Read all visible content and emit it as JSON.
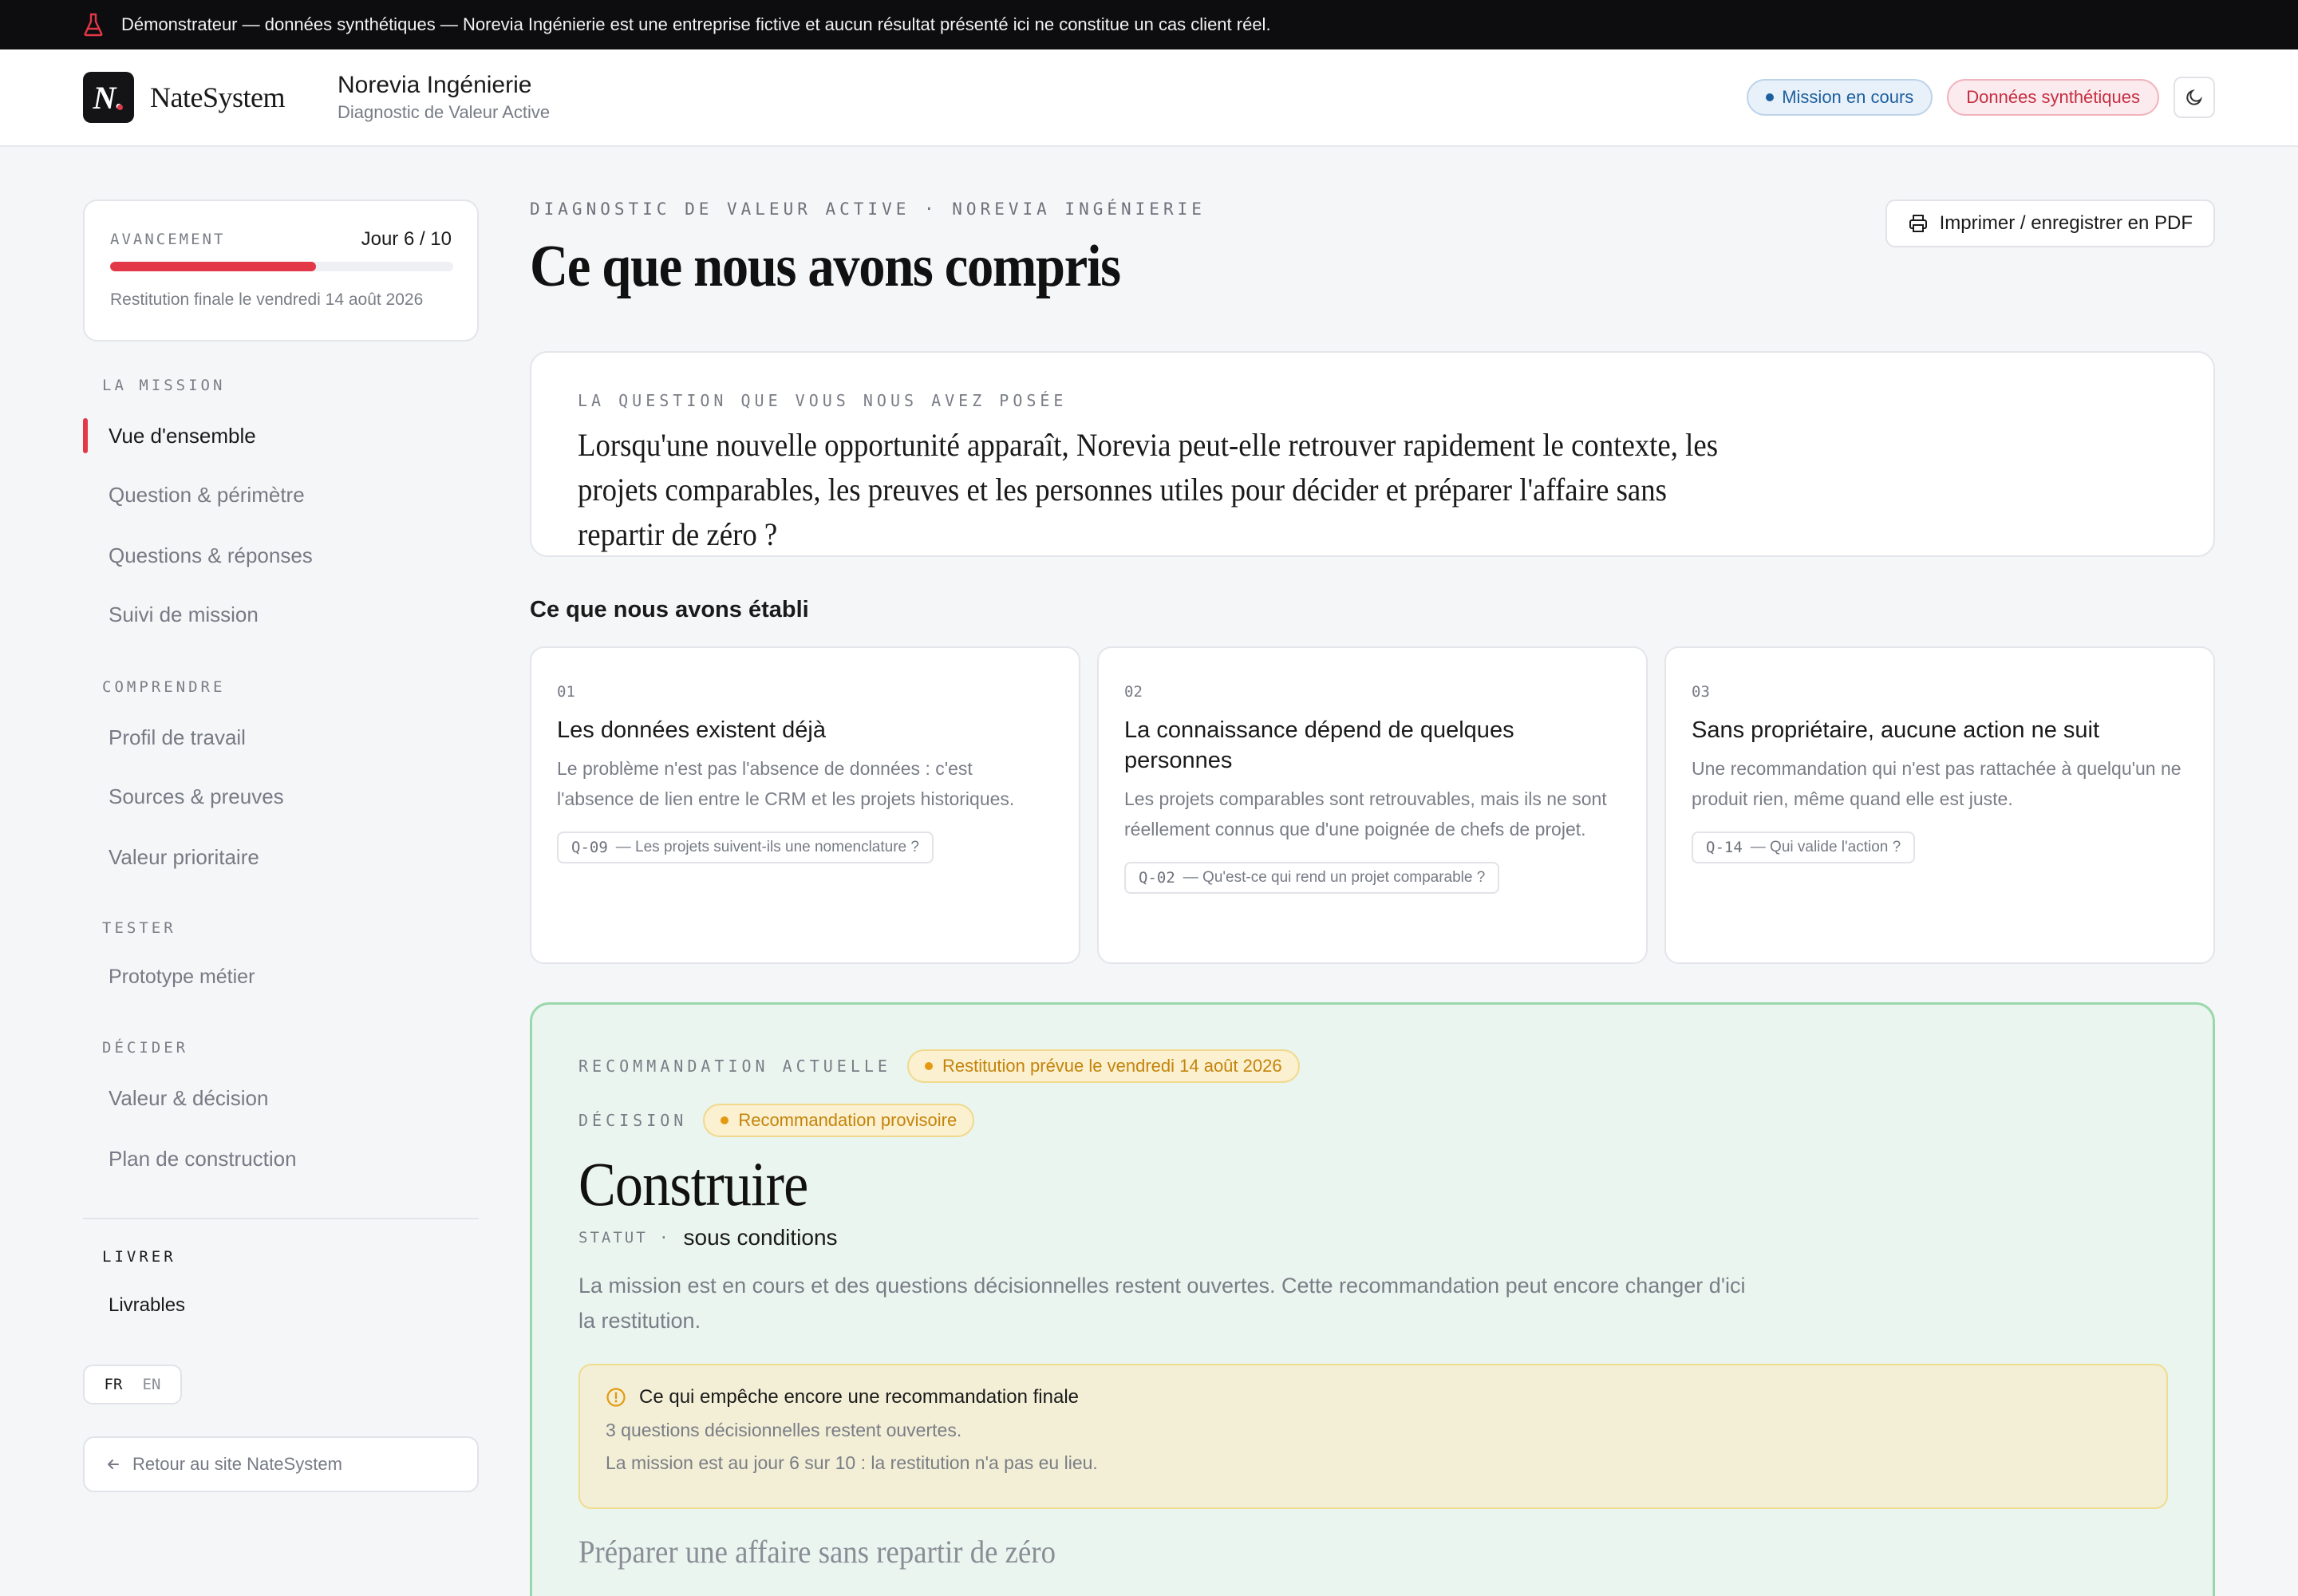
{
  "banner": {
    "text": "Démonstrateur — données synthétiques — Norevia Ingénierie est une entreprise fictive et aucun résultat présenté ici ne constitue un cas client réel."
  },
  "header": {
    "brand": "NateSystem",
    "logo_letter": "N.",
    "client_name": "Norevia Ingénierie",
    "client_sub": "Diagnostic de Valeur Active",
    "pill_mission": "Mission en cours",
    "pill_synthetic": "Données synthétiques"
  },
  "colors": {
    "accent_red": "#e23848",
    "reco_green_border": "#9ad8ab",
    "pending_amber": "#e39a10"
  },
  "sidebar": {
    "progress": {
      "label": "AVANCEMENT",
      "day": "Jour 6 / 10",
      "fraction": 0.6,
      "note": "Restitution finale le vendredi 14 août 2026"
    },
    "sections": [
      {
        "title": "LA MISSION",
        "items": [
          "Vue d'ensemble",
          "Question & périmètre",
          "Questions & réponses",
          "Suivi de mission"
        ]
      },
      {
        "title": "COMPRENDRE",
        "items": [
          "Profil de travail",
          "Sources & preuves",
          "Valeur prioritaire"
        ]
      },
      {
        "title": "TESTER",
        "items": [
          "Prototype métier"
        ]
      },
      {
        "title": "DÉCIDER",
        "items": [
          "Valeur & décision",
          "Plan de construction"
        ]
      },
      {
        "title": "LIVRER",
        "items": [
          "Livrables"
        ]
      }
    ],
    "active_item": "Vue d'ensemble",
    "lang": {
      "fr": "FR",
      "en": "EN"
    },
    "back_label": "Retour au site NateSystem"
  },
  "main": {
    "eyebrow": "DIAGNOSTIC DE VALEUR ACTIVE · NOREVIA INGÉNIERIE",
    "title": "Ce que nous avons compris",
    "print_label": "Imprimer / enregistrer en PDF",
    "question": {
      "label": "LA QUESTION QUE VOUS NOUS AVEZ POSÉE",
      "text": "Lorsqu'une nouvelle opportunité apparaît, Norevia peut-elle retrouver rapidement le contexte, les projets comparables, les preuves et les personnes utiles pour décider et préparer l'affaire sans repartir de zéro ?"
    },
    "established_title": "Ce que nous avons établi",
    "cards": [
      {
        "num": "01",
        "title": "Les données existent déjà",
        "body": "Le problème n'est pas l'absence de données : c'est l'absence de lien entre le CRM et les projets historiques.",
        "tag_code": "Q-09",
        "tag_text": "— Les projets suivent-ils une nomenclature ?"
      },
      {
        "num": "02",
        "title": "La connaissance dépend de quelques personnes",
        "body": "Les projets comparables sont retrouvables, mais ils ne sont réellement connus que d'une poignée de chefs de projet.",
        "tag_code": "Q-02",
        "tag_text": "— Qu'est-ce qui rend un projet comparable ?"
      },
      {
        "num": "03",
        "title": "Sans propriétaire, aucune action ne suit",
        "body": "Une recommandation qui n'est pas rattachée à quelqu'un ne produit rien, même quand elle est juste.",
        "tag_code": "Q-14",
        "tag_text": "— Qui valide l'action ?"
      }
    ],
    "reco": {
      "label": "RECOMMANDATION ACTUELLE",
      "restitution_pill": "Restitution prévue le vendredi 14 août 2026",
      "decision_label": "DÉCISION",
      "decision_pill": "Recommandation provisoire",
      "title": "Construire",
      "statut_label": "STATUT ·",
      "statut_value": "sous conditions",
      "description": "La mission est en cours et des questions décisionnelles restent ouvertes. Cette recommandation peut encore changer d'ici la restitution.",
      "blocker_title": "Ce qui empêche encore une recommandation finale",
      "blocker_lines": [
        "3 questions décisionnelles restent ouvertes.",
        "La mission est au jour 6 sur 10 : la restitution n'a pas eu lieu."
      ],
      "subtitle": "Préparer une affaire sans repartir de zéro"
    }
  }
}
